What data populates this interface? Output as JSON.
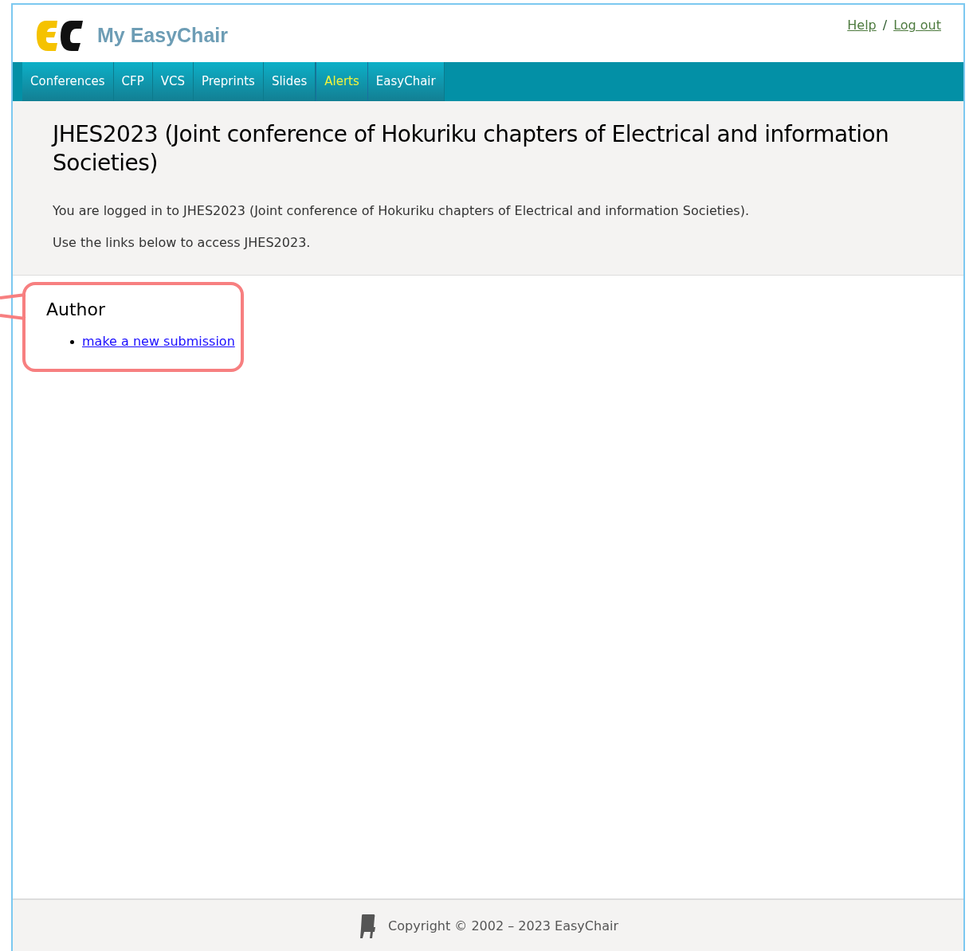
{
  "header": {
    "site_title": "My EasyChair",
    "links": [
      "Help",
      "Log out"
    ],
    "separator": "/"
  },
  "menu": [
    {
      "label": "Conferences",
      "highlighted": false
    },
    {
      "label": "CFP",
      "highlighted": false
    },
    {
      "label": "VCS",
      "highlighted": false
    },
    {
      "label": "Preprints",
      "highlighted": false
    },
    {
      "label": "Slides",
      "highlighted": false
    },
    {
      "label": "Alerts",
      "highlighted": true
    },
    {
      "label": "EasyChair",
      "highlighted": false
    }
  ],
  "intro": {
    "title": "JHES2023 (Joint conference of Hokuriku chapters of Electrical and information Societies)",
    "paragraphs": [
      "You are logged in to JHES2023 (Joint conference of Hokuriku chapters of Electrical and information Societies).",
      "Use the links below to access JHES2023."
    ]
  },
  "sections": [
    {
      "heading": "Author",
      "links": [
        "make a new submission"
      ],
      "highlighted": true
    }
  ],
  "footer": {
    "copyright": "Copyright © 2002 – 2023 EasyChair"
  }
}
